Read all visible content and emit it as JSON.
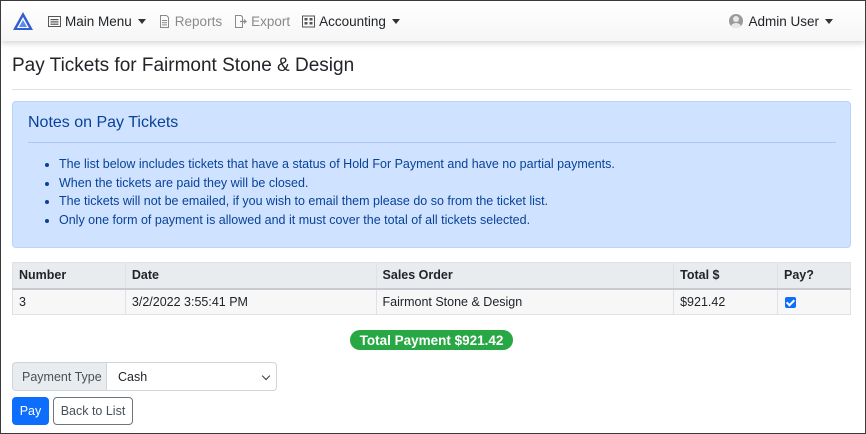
{
  "navbar": {
    "brand_icon": "triangle-logo-icon",
    "items": [
      {
        "label": "Main Menu",
        "icon": "menu-list-icon",
        "dropdown": true,
        "disabled": false
      },
      {
        "label": "Reports",
        "icon": "report-icon",
        "dropdown": false,
        "disabled": true
      },
      {
        "label": "Export",
        "icon": "export-icon",
        "dropdown": false,
        "disabled": true
      },
      {
        "label": "Accounting",
        "icon": "calculator-icon",
        "dropdown": true,
        "disabled": false
      }
    ],
    "user": {
      "label": "Admin User",
      "icon": "user-avatar-icon"
    }
  },
  "page": {
    "title": "Pay Tickets for Fairmont Stone & Design"
  },
  "notes": {
    "title": "Notes on Pay Tickets",
    "items": [
      "The list below includes tickets that have a status of Hold For Payment and have no partial payments.",
      "When the tickets are paid they will be closed.",
      "The tickets will not be emailed, if you wish to email them please do so from the ticket list.",
      "Only one form of payment is allowed and it must cover the total of all tickets selected."
    ]
  },
  "table": {
    "headers": [
      "Number",
      "Date",
      "Sales Order",
      "Total $",
      "Pay?"
    ],
    "rows": [
      {
        "number": "3",
        "date": "3/2/2022 3:55:41 PM",
        "sales_order": "Fairmont Stone & Design",
        "total": "$921.42",
        "pay": true
      }
    ]
  },
  "total_badge": "Total Payment $921.42",
  "payment": {
    "label": "Payment Type",
    "selected": "Cash"
  },
  "buttons": {
    "pay": "Pay",
    "back": "Back to List"
  },
  "colors": {
    "primary": "#0d6efd",
    "success": "#28a745",
    "alert_bg": "#cfe2ff",
    "alert_text": "#084298"
  }
}
